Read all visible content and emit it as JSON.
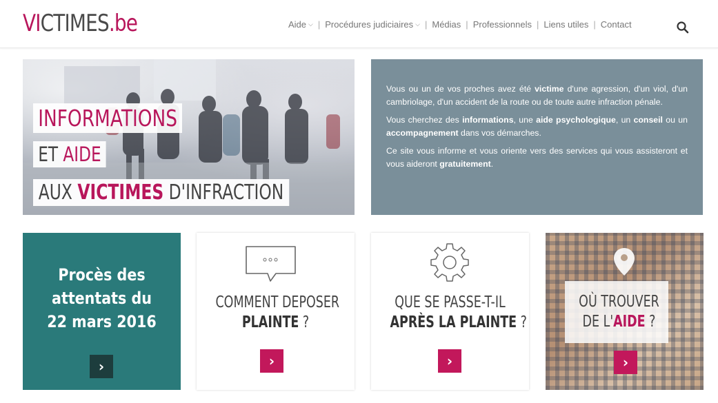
{
  "logo": {
    "part1": "VI",
    "part2": "CTIMES",
    "part3": ".be"
  },
  "nav": {
    "items": [
      {
        "label": "Aide",
        "dropdown": true
      },
      {
        "label": "Procédures judiciaires",
        "dropdown": true
      },
      {
        "label": "Médias",
        "dropdown": false
      },
      {
        "label": "Professionnels",
        "dropdown": false
      },
      {
        "label": "Liens utiles",
        "dropdown": false
      },
      {
        "label": "Contact",
        "dropdown": false
      }
    ],
    "search_icon": "search-icon"
  },
  "hero": {
    "line1": "INFORMATIONS",
    "line2_a": "ET ",
    "line2_b": "AIDE",
    "line3_a": "AUX ",
    "line3_b": "VICTIMES",
    "line3_c": " D'INFRACTION"
  },
  "info": {
    "p1_a": "Vous ou un de vos proches avez été ",
    "p1_b": "victime",
    "p1_c": " d'une agression, d'un viol, d'un cambriolage, d'un accident de la route ou de toute autre infraction pénale.",
    "p2_a": "Vous cherchez des ",
    "p2_b": "informations",
    "p2_c": ", une ",
    "p2_d": "aide psychologique",
    "p2_e": ", un ",
    "p2_f": "conseil",
    "p2_g": " ou un ",
    "p2_h": "accompagnement",
    "p2_i": " dans vos démarches.",
    "p3_a": "Ce site vous informe et vous oriente vers des services qui vous assisteront et vous aideront ",
    "p3_b": "gratuitement",
    "p3_c": "."
  },
  "cards": {
    "proces": {
      "line1": "Procès des",
      "line2": "attentats du",
      "line3": "22 mars 2016",
      "arrow": "›"
    },
    "plainte": {
      "line1": "COMMENT DEPOSER",
      "line2_a": "PLAINTE",
      "line2_b": " ?",
      "arrow": "›",
      "icon": "chat-bubble-icon"
    },
    "apres": {
      "line1": "QUE SE PASSE-T-IL",
      "line2_a": "APRÈS LA PLAINTE",
      "line2_b": " ?",
      "arrow": "›",
      "icon": "gear-icon"
    },
    "trouver": {
      "line1": "OÙ TROUVER",
      "line2_a": "DE L'",
      "line2_b": "AIDE",
      "line2_c": " ?",
      "arrow": "›",
      "icon": "map-pin-icon"
    }
  },
  "colors": {
    "brand": "#b8165b",
    "teal": "#2a7a7a",
    "info_bg": "#7a8f9a",
    "arrow_pink": "#c2185b"
  }
}
